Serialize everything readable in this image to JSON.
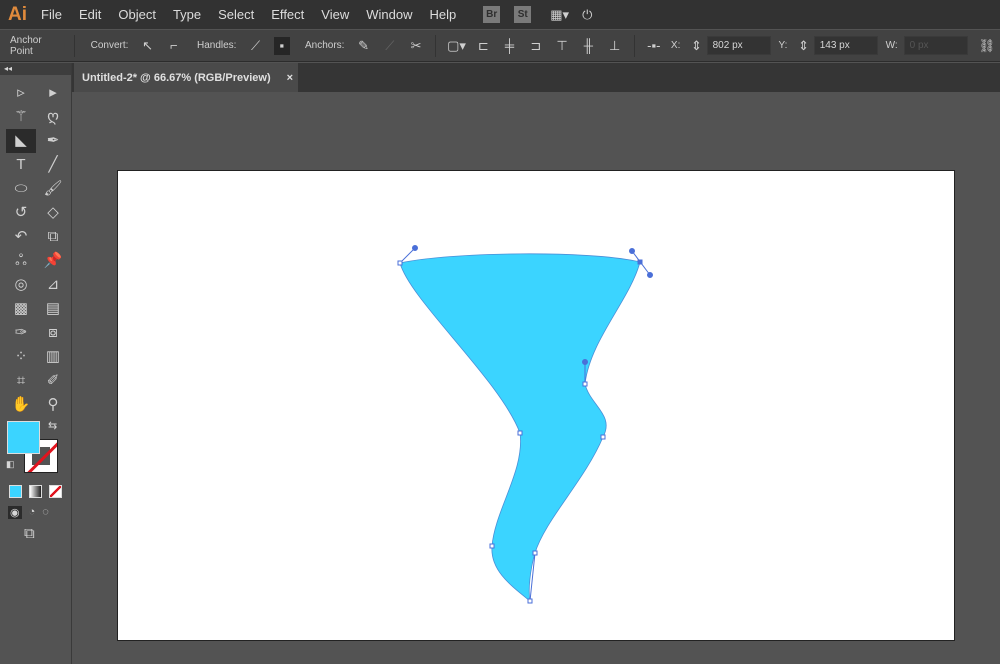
{
  "app": {
    "logo": "Ai"
  },
  "menu": [
    "File",
    "Edit",
    "Object",
    "Type",
    "Select",
    "Effect",
    "View",
    "Window",
    "Help"
  ],
  "menu_icons": {
    "bridge": "Br",
    "stock": "St"
  },
  "control": {
    "tool_name": "Anchor Point",
    "convert_label": "Convert:",
    "handles_label": "Handles:",
    "anchors_label": "Anchors:",
    "x_label": "X:",
    "x_value": "802 px",
    "y_label": "Y:",
    "y_value": "143 px",
    "w_label": "W:",
    "w_value": "0 px"
  },
  "tab": {
    "title": "Untitled-2* @ 66.67% (RGB/Preview)",
    "close": "×"
  },
  "toolbar": {
    "collapse": "◂◂",
    "tools": [
      "selection-tool",
      "direct-selection-tool",
      "magic-wand-tool",
      "lasso-tool",
      "pen-tool",
      "curvature-tool",
      "type-tool",
      "line-tool",
      "ellipse-tool",
      "paintbrush-tool",
      "shaper-tool",
      "eraser-tool",
      "rotate-tool",
      "scale-tool",
      "warp-tool",
      "puppet-warp-tool",
      "shape-builder-tool",
      "perspective-grid-tool",
      "mesh-tool",
      "gradient-tool",
      "eyedropper-tool",
      "blend-tool",
      "symbol-sprayer-tool",
      "column-graph-tool",
      "artboard-tool",
      "slice-tool",
      "hand-tool",
      "zoom-tool"
    ],
    "active_tool": "anchor-point-tool"
  },
  "colors": {
    "fill": "#3bd4ff",
    "stroke": "none",
    "accent": "#4a6fd8",
    "menubar": "#323232",
    "panel": "#424242",
    "canvas": "#535353"
  }
}
